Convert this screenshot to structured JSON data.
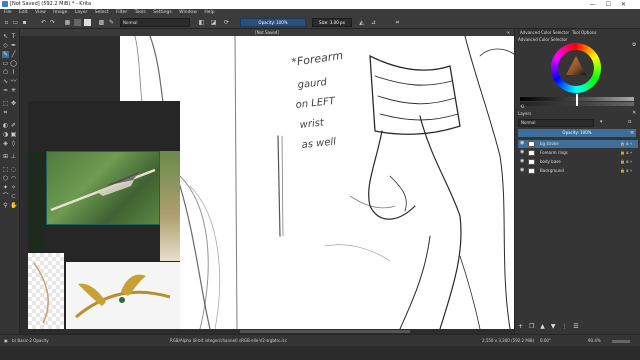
{
  "app": {
    "title": "[Not Saved]  (592.2 MiB) * - Krita",
    "window_controls": [
      "—",
      "☐",
      "✕"
    ]
  },
  "menubar": [
    "File",
    "Edit",
    "View",
    "Image",
    "Layer",
    "Select",
    "Filter",
    "Tools",
    "Settings",
    "Window",
    "Help"
  ],
  "toolbar": {
    "blend_mode": "Normal",
    "opacity_label": "Opacity: 100%",
    "size_label": "Size: 3.00 px"
  },
  "document": {
    "tab_title": "[Not Saved]",
    "close_glyph": "✕"
  },
  "right_panel": {
    "tab_colors": "Advanced Color Selector",
    "tab_tool_options": "Tool Options",
    "color_selector_title": "Advanced Color Selector",
    "layers_title": "Layers",
    "blend_mode": "Normal",
    "layer_opacity": "Opacity: 100%",
    "layers": [
      {
        "name": "bg stroke",
        "selected": true
      },
      {
        "name": "Forearm rings",
        "selected": false
      },
      {
        "name": "body base",
        "selected": false
      },
      {
        "name": "Background",
        "selected": false
      }
    ],
    "layer_buttons": [
      "+",
      "❐",
      "▲",
      "▼",
      "⋮",
      "☰"
    ]
  },
  "canvas_annotation": "*Forearm gaurd on LEFT wrist as well",
  "statusbar": {
    "brush": "b) Basic-2 Opacity",
    "color_info": "RGB/Alpha (8-bit integer/channel)  sRGB-elle-V2-srgbtrc.icc",
    "dimensions": "2,550 x 3,300 (592.2 MiB)",
    "rotation": "0.00°",
    "zoom": "90.4%"
  },
  "colors": {
    "accent": "#3e6f9b",
    "panel": "#353535",
    "canvas": "#ffffff"
  }
}
